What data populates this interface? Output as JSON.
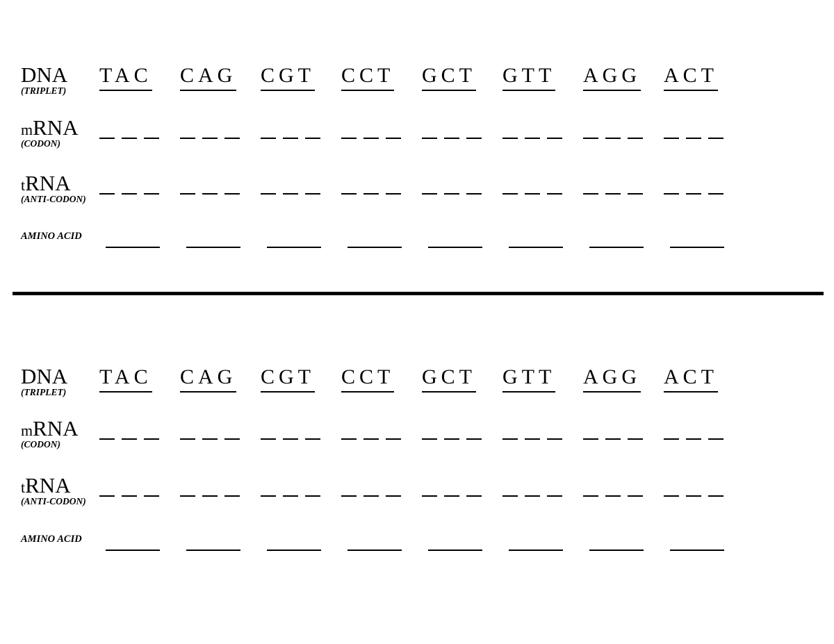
{
  "document": {
    "type": "genetics-transcription-translation-worksheet",
    "divider": true
  },
  "rows": {
    "dna": {
      "main": "DNA",
      "sub": "(TRIPLET)"
    },
    "mrna": {
      "prefix": "m",
      "main": "RNA",
      "sub": "(CODON)"
    },
    "trna": {
      "prefix": "t",
      "main": "RNA",
      "sub": "(ANTI-CODON)"
    },
    "amino": {
      "main": "AMINO ACID"
    }
  },
  "dna_triplets": [
    "TAC",
    "CAG",
    "CGT",
    "CCT",
    "GCT",
    "GTT",
    "AGG",
    "ACT"
  ],
  "blanks": {
    "nucleotides_per_codon": 3,
    "codon_count": 8
  },
  "worksheets": [
    {
      "id": "top",
      "dna_triplets": [
        "TAC",
        "CAG",
        "CGT",
        "CCT",
        "GCT",
        "GTT",
        "AGG",
        "ACT"
      ]
    },
    {
      "id": "bottom",
      "dna_triplets": [
        "TAC",
        "CAG",
        "CGT",
        "CCT",
        "GCT",
        "GTT",
        "AGG",
        "ACT"
      ]
    }
  ]
}
